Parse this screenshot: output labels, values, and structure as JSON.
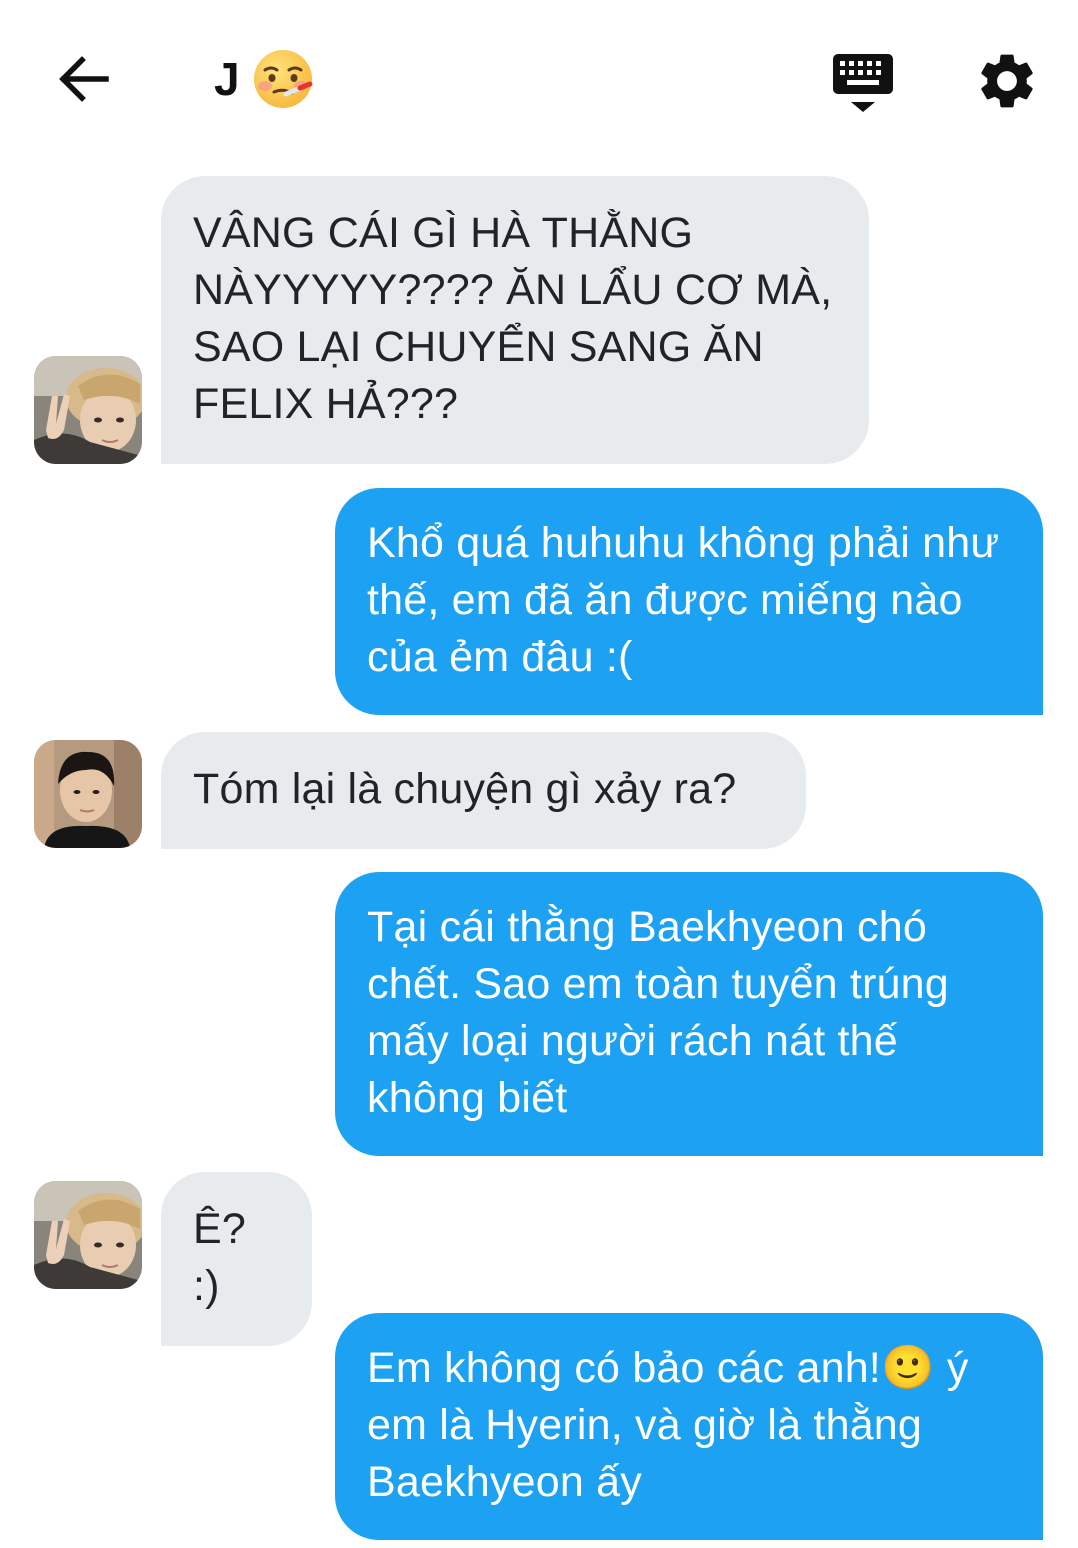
{
  "header": {
    "back_icon": "arrow-left-icon",
    "title": "J",
    "title_emoji": "face-with-thermometer-icon",
    "keyboard_icon": "keyboard-hide-icon",
    "settings_icon": "gear-icon"
  },
  "colors": {
    "sent_bubble": "#1da1f2",
    "received_bubble": "#e8ebee",
    "background": "#ffffff"
  },
  "messages": [
    {
      "sender": "them",
      "avatar": "avatar-boy-peace-sign",
      "text": "VÂNG CÁI GÌ HÀ THẰNG NÀYYYYY???? ĂN LẨU CƠ MÀ, SAO LẠI CHUYỂN SANG ĂN FELIX HẢ???"
    },
    {
      "sender": "me",
      "text": "Khổ quá huhuhu không phải như thế, em đã ăn được miếng nào của ẻm đâu :("
    },
    {
      "sender": "them",
      "avatar": "avatar-boy-dark-hair",
      "text": "Tóm lại là chuyện gì xảy ra?"
    },
    {
      "sender": "me",
      "text": "Tại cái thằng Baekhyeon chó chết. Sao em toàn tuyển trúng mấy loại người rách nát thế không biết"
    },
    {
      "sender": "them",
      "avatar": "avatar-boy-peace-sign",
      "text": "Ê? :)"
    },
    {
      "sender": "me",
      "text": "Em không có bảo các anh!🙂 ý em là Hyerin, và giờ là thằng Baekhyeon ấy"
    }
  ]
}
